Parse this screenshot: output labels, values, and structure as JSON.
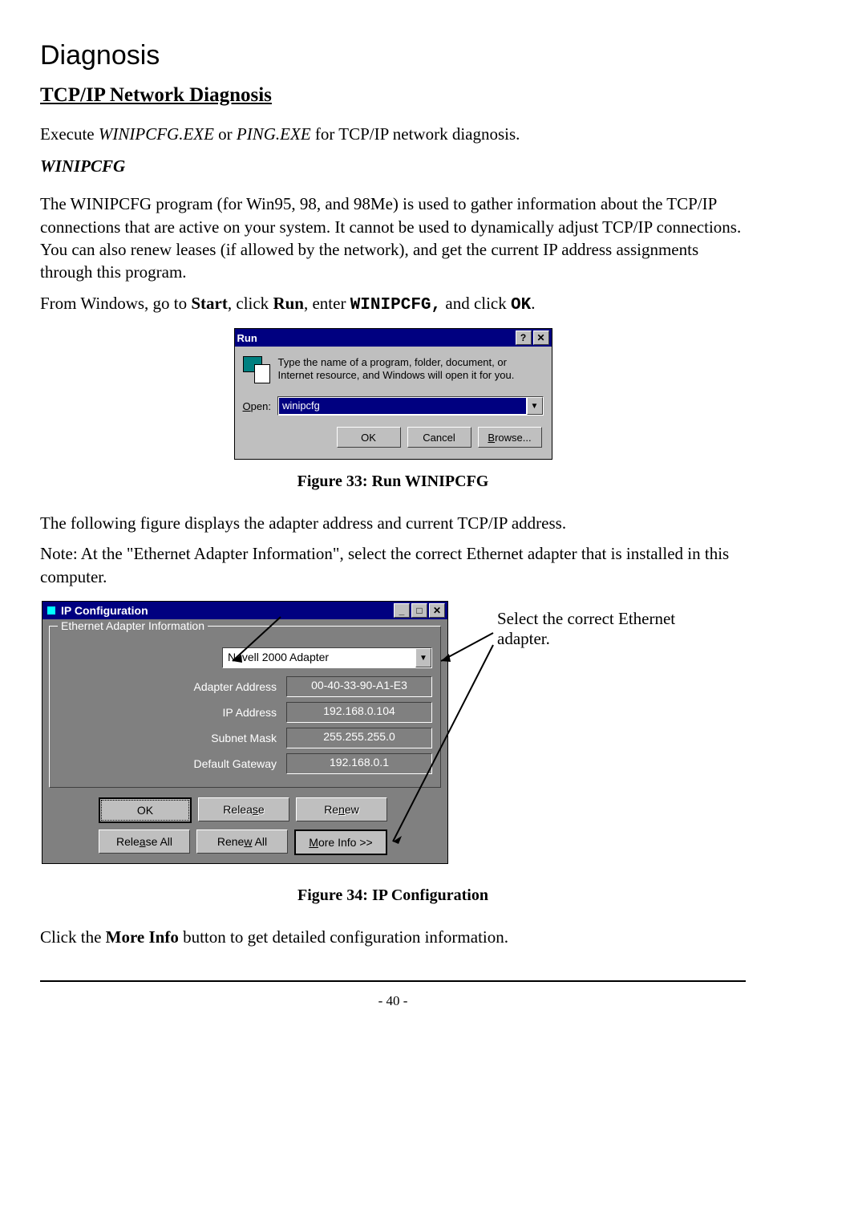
{
  "headings": {
    "page": "Diagnosis",
    "section": "TCP/IP Network Diagnosis",
    "sub": "WINIPCFG"
  },
  "body": {
    "p1_a": "Execute ",
    "p1_exe1": "WINIPCFG.EXE",
    "p1_b": " or ",
    "p1_exe2": "PING.EXE",
    "p1_c": " for TCP/IP network diagnosis.",
    "p2": "The WINIPCFG program (for Win95, 98, and 98Me) is used to gather information about the TCP/IP connections that are active on your system. It cannot be used to dynamically adjust TCP/IP connections. You can also renew leases (if allowed by the network), and get the current IP address assignments through this program.",
    "p3_a": "From Windows, go to ",
    "p3_start": "Start",
    "p3_b": ", click ",
    "p3_run": "Run",
    "p3_c": ", enter ",
    "p3_cmd": "WINIPCFG,",
    "p3_d": " and click ",
    "p3_ok": "OK",
    "p3_e": ".",
    "p4": "The following figure displays the adapter address and current TCP/IP address.",
    "p5": "Note: At the \"Ethernet Adapter Information\", select the correct Ethernet adapter that is installed in this computer.",
    "p6_a": "Click the ",
    "p6_btn": "More Info",
    "p6_b": " button to get detailed configuration information."
  },
  "captions": {
    "fig33": "Figure 33: Run WINIPCFG",
    "fig34": "Figure 34: IP Configuration"
  },
  "run": {
    "title": "Run",
    "help_glyph": "?",
    "close_glyph": "✕",
    "description": "Type the name of a program, folder, document, or Internet resource, and Windows will open it for you.",
    "open_label_pre": "O",
    "open_label_post": "pen:",
    "value": "winipcfg",
    "dropdown_glyph": "▼",
    "ok": "OK",
    "cancel": "Cancel",
    "browse": "Browse..."
  },
  "ipcfg": {
    "title": "IP Configuration",
    "min_glyph": "_",
    "max_glyph": "□",
    "close_glyph": "✕",
    "group_legend": "Ethernet  Adapter Information",
    "adapter_value": "Novell 2000 Adapter",
    "dropdown_glyph": "▼",
    "fields": {
      "adapter_address": {
        "label": "Adapter Address",
        "value": "00-40-33-90-A1-E3"
      },
      "ip_address": {
        "label": "IP Address",
        "value": "192.168.0.104"
      },
      "subnet_mask": {
        "label": "Subnet Mask",
        "value": "255.255.255.0"
      },
      "default_gateway": {
        "label": "Default Gateway",
        "value": "192.168.0.1"
      }
    },
    "buttons": {
      "ok": "OK",
      "release": "Release",
      "renew": "Renew",
      "release_all": "Release All",
      "renew_all": "Renew All",
      "more_info": "More Info >>"
    }
  },
  "callout": "Select the correct Ethernet adapter.",
  "page_number": "- 40 -"
}
